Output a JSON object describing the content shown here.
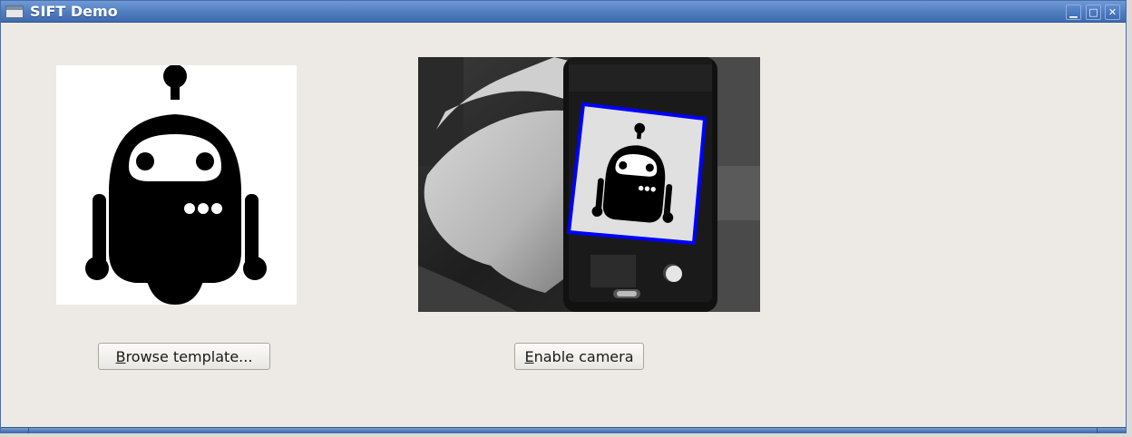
{
  "window": {
    "title": "SIFT Demo",
    "controls": {
      "minimize": "▁",
      "maximize": "□",
      "close": "✕"
    }
  },
  "template": {
    "button_mnemonic": "B",
    "button_rest": "rowse template..."
  },
  "camera": {
    "button_mnemonic": "E",
    "button_rest": "nable camera"
  },
  "colors": {
    "title_bar": "#4f7cbf",
    "detection_box": "#0000ff",
    "background": "#edeae5"
  }
}
